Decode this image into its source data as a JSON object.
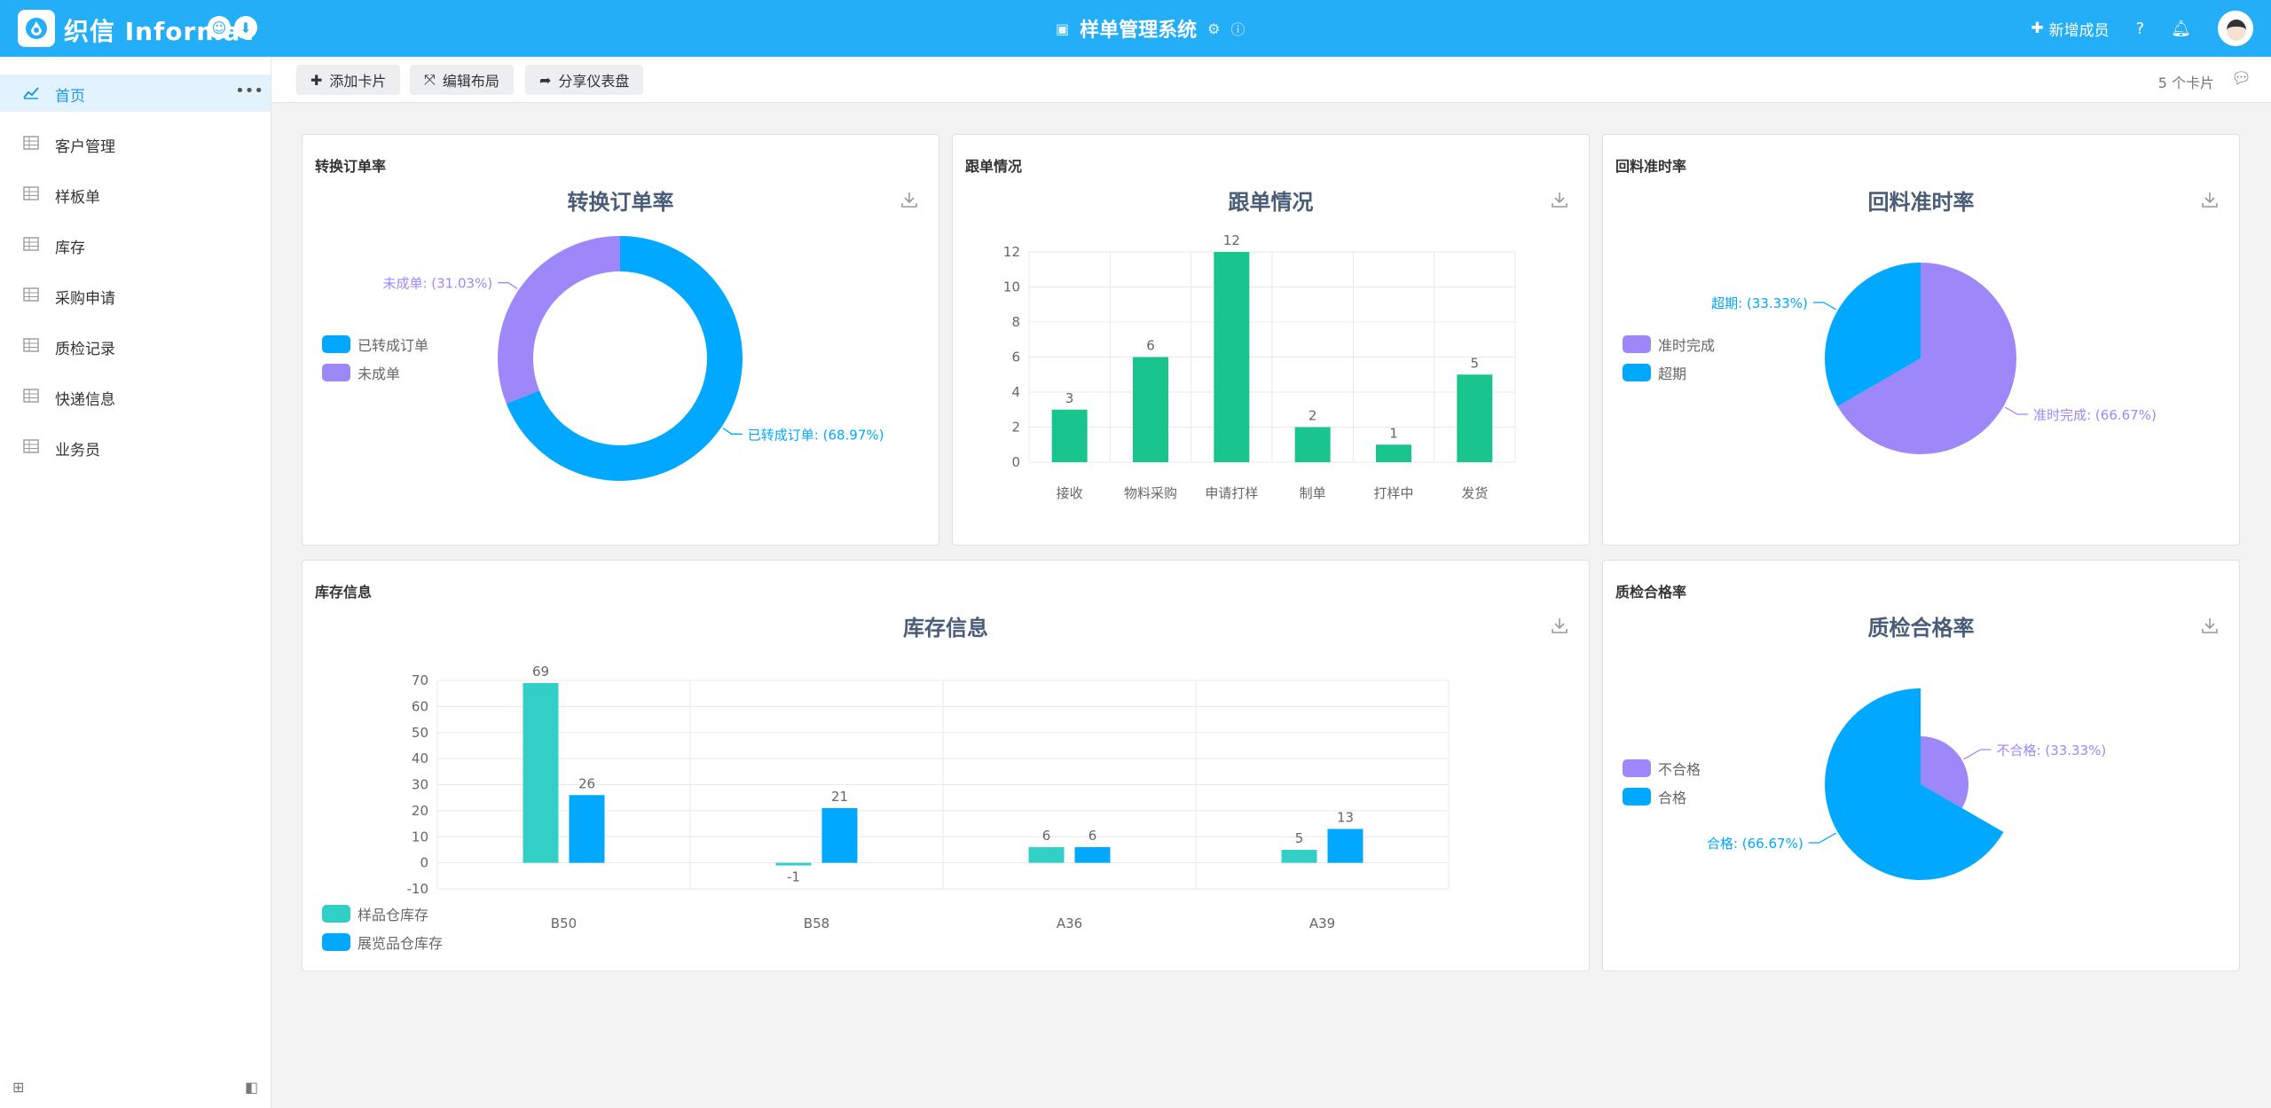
{
  "header": {
    "brand": "织信 Informat",
    "app_title": "样单管理系统",
    "new_member": "新增成员"
  },
  "sidebar": {
    "items": [
      {
        "label": "首页",
        "icon": "line-chart-icon"
      },
      {
        "label": "客户管理",
        "icon": "table-icon"
      },
      {
        "label": "样板单",
        "icon": "table-icon"
      },
      {
        "label": "库存",
        "icon": "table-icon"
      },
      {
        "label": "采购申请",
        "icon": "table-icon"
      },
      {
        "label": "质检记录",
        "icon": "table-icon"
      },
      {
        "label": "快递信息",
        "icon": "table-icon"
      },
      {
        "label": "业务员",
        "icon": "table-icon"
      }
    ],
    "more": "•••"
  },
  "toolbar": {
    "add_card": "添加卡片",
    "edit_layout": "编辑布局",
    "share_dashboard": "分享仪表盘",
    "card_count": "5 个卡片"
  },
  "colors": {
    "header": "#25aef8",
    "blue": "#00a8ff",
    "purple": "#9d87f9",
    "green": "#19c48d",
    "teal": "#32cfc6",
    "title": "#4a5d78"
  },
  "cards": {
    "conversion": {
      "label": "转换订单率",
      "title": "转换订单率",
      "chart_data": {
        "type": "pie",
        "variant": "donut",
        "slices": [
          {
            "label": "已转成订单",
            "value": 68.97,
            "display": "已转成订单: (68.97%)",
            "color": "#00a8ff"
          },
          {
            "label": "未成单",
            "value": 31.03,
            "display": "未成单: (31.03%)",
            "color": "#9d87f9"
          }
        ],
        "legend": "left"
      }
    },
    "followup": {
      "label": "跟单情况",
      "title": "跟单情况",
      "chart_data": {
        "type": "bar",
        "categories": [
          "接收",
          "物料采购",
          "申请打样",
          "制单",
          "打样中",
          "发货"
        ],
        "values": [
          3,
          6,
          12,
          2,
          1,
          5
        ],
        "ylim": [
          0,
          12
        ],
        "yticks": [
          0,
          2,
          4,
          6,
          8,
          10,
          12
        ],
        "color": "#19c48d",
        "grid": true
      }
    },
    "ontime": {
      "label": "回料准时率",
      "title": "回料准时率",
      "chart_data": {
        "type": "pie",
        "slices": [
          {
            "label": "准时完成",
            "value": 66.67,
            "display": "准时完成: (66.67%)",
            "color": "#9d87f9"
          },
          {
            "label": "超期",
            "value": 33.33,
            "display": "超期: (33.33%)",
            "color": "#00a8ff"
          }
        ],
        "legend": "left"
      }
    },
    "inventory": {
      "label": "库存信息",
      "title": "库存信息",
      "chart_data": {
        "type": "bar",
        "categories": [
          "B50",
          "B58",
          "A36",
          "A39"
        ],
        "series": [
          {
            "name": "样品仓库存",
            "values": [
              69,
              -1,
              6,
              5
            ],
            "color": "#32cfc6"
          },
          {
            "name": "展览品仓库存",
            "values": [
              26,
              21,
              6,
              13
            ],
            "color": "#00a8ff"
          }
        ],
        "ylim": [
          -10,
          70
        ],
        "yticks": [
          -10,
          0,
          10,
          20,
          30,
          40,
          50,
          60,
          70
        ],
        "grid": true,
        "legend": "bottom-left"
      }
    },
    "quality": {
      "label": "质检合格率",
      "title": "质检合格率",
      "chart_data": {
        "type": "pie",
        "variant": "rose",
        "slices": [
          {
            "label": "不合格",
            "value": 33.33,
            "display": "不合格: (33.33%)",
            "color": "#9d87f9"
          },
          {
            "label": "合格",
            "value": 66.67,
            "display": "合格: (66.67%)",
            "color": "#00a8ff"
          }
        ],
        "legend": "left"
      }
    }
  }
}
